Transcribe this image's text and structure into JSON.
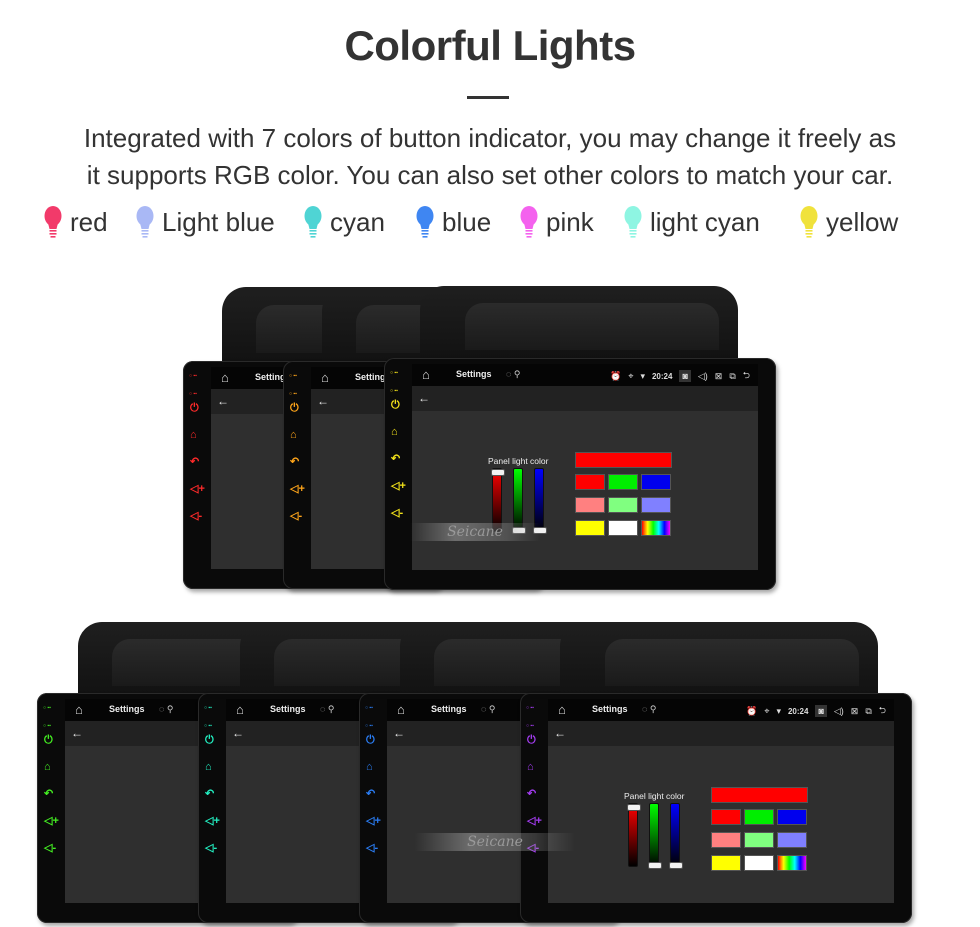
{
  "header": {
    "title": "Colorful Lights",
    "description_line1": "Integrated with 7 colors of button indicator, you may change it freely as",
    "description_line2": "it supports RGB color. You can also set other colors to match your car."
  },
  "legend": [
    {
      "label": "red",
      "color": "#f23a6a",
      "icon": "light-bulb-icon"
    },
    {
      "label": "Light blue",
      "color": "#a9b8f5",
      "icon": "light-bulb-icon"
    },
    {
      "label": "cyan",
      "color": "#4fd4d4",
      "icon": "light-bulb-icon"
    },
    {
      "label": "blue",
      "color": "#3f86f2",
      "icon": "light-bulb-icon"
    },
    {
      "label": "pink",
      "color": "#f462ee",
      "icon": "light-bulb-icon"
    },
    {
      "label": "light cyan",
      "color": "#8ef5e2",
      "icon": "light-bulb-icon"
    },
    {
      "label": "yellow",
      "color": "#f0e23c",
      "icon": "light-bulb-icon"
    }
  ],
  "device_screen": {
    "status_title": "Settings",
    "status_time": "20:24",
    "panel_label": "Panel light color",
    "watermark": "Seicane",
    "status_icons": [
      "home-icon",
      "brightness-icon",
      "usb-icon",
      "alarm-icon",
      "location-icon",
      "wifi-icon",
      "screenshot-icon",
      "volume-icon",
      "close-window-icon",
      "recent-apps-icon",
      "back-icon"
    ],
    "side_keys": [
      "power-icon",
      "home-icon",
      "back-icon",
      "volume-up-icon",
      "volume-down-icon"
    ],
    "sliders": [
      {
        "channel": "red",
        "value_pct": 100,
        "color": "#ff0000"
      },
      {
        "channel": "green",
        "value_pct": 0,
        "color": "#00ff00"
      },
      {
        "channel": "blue",
        "value_pct": 0,
        "color": "#0000ff"
      }
    ],
    "swatches": [
      {
        "name": "current",
        "color": "#ff0000"
      },
      {
        "name": "red",
        "color": "#ff0000"
      },
      {
        "name": "green",
        "color": "#00ee00"
      },
      {
        "name": "blue",
        "color": "#0000ee"
      },
      {
        "name": "light-red",
        "color": "#ff8080"
      },
      {
        "name": "light-green",
        "color": "#80ff80"
      },
      {
        "name": "light-blue",
        "color": "#8080ff"
      },
      {
        "name": "yellow",
        "color": "#ffff00"
      },
      {
        "name": "white",
        "color": "#ffffff"
      },
      {
        "name": "rainbow",
        "color": "rainbow"
      }
    ]
  },
  "units": [
    {
      "key_color": "#ff2a2a"
    },
    {
      "key_color": "#ffa51a"
    },
    {
      "key_color": "#f2e21a"
    },
    {
      "key_color": "#44ee22"
    },
    {
      "key_color": "#22eec0"
    },
    {
      "key_color": "#2a7cf2"
    },
    {
      "key_color": "#a33cf0"
    }
  ]
}
